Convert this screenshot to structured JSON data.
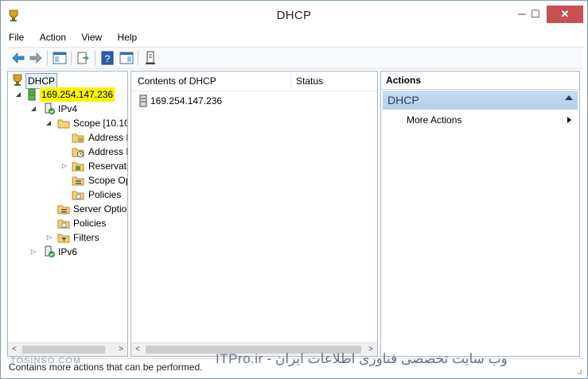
{
  "window": {
    "title": "DHCP",
    "controls": {
      "minimize": "─",
      "maximize": "☐",
      "close": "✕"
    }
  },
  "menu": [
    "File",
    "Action",
    "View",
    "Help"
  ],
  "toolbar": {
    "buttons": [
      "back-arrow-icon",
      "forward-arrow-icon",
      "show-hide-tree-icon",
      "export-list-icon",
      "help-icon",
      "show-hide-action-pane-icon",
      "server-icon"
    ]
  },
  "tree": {
    "root": "DHCP",
    "server": "169.254.147.236",
    "ipv4": "IPv4",
    "scope": "Scope [10.10",
    "address_pool": "Address P",
    "address_leases": "Address L",
    "reservations": "Reservati",
    "scope_options": "Scope Op",
    "scope_policies": "Policies",
    "server_options": "Server Option",
    "policies": "Policies",
    "filters": "Filters",
    "ipv6": "IPv6"
  },
  "contents": {
    "columns": [
      "Contents of DHCP",
      "Status"
    ],
    "rows": [
      {
        "name": "169.254.147.236",
        "status": ""
      }
    ]
  },
  "actions": {
    "header": "Actions",
    "section": "DHCP",
    "items": [
      "More Actions"
    ]
  },
  "statusbar": {
    "text": "Contains more actions that can be performed."
  },
  "watermarks": {
    "left": "TOSINSO.COM",
    "rtl": "وب سایت تخصصی فناوری اطلاعات ایران - ITPro.ir"
  },
  "colors": {
    "highlight": "#f8f500",
    "action_section": "#b5cde8",
    "close_button": "#c75050"
  }
}
